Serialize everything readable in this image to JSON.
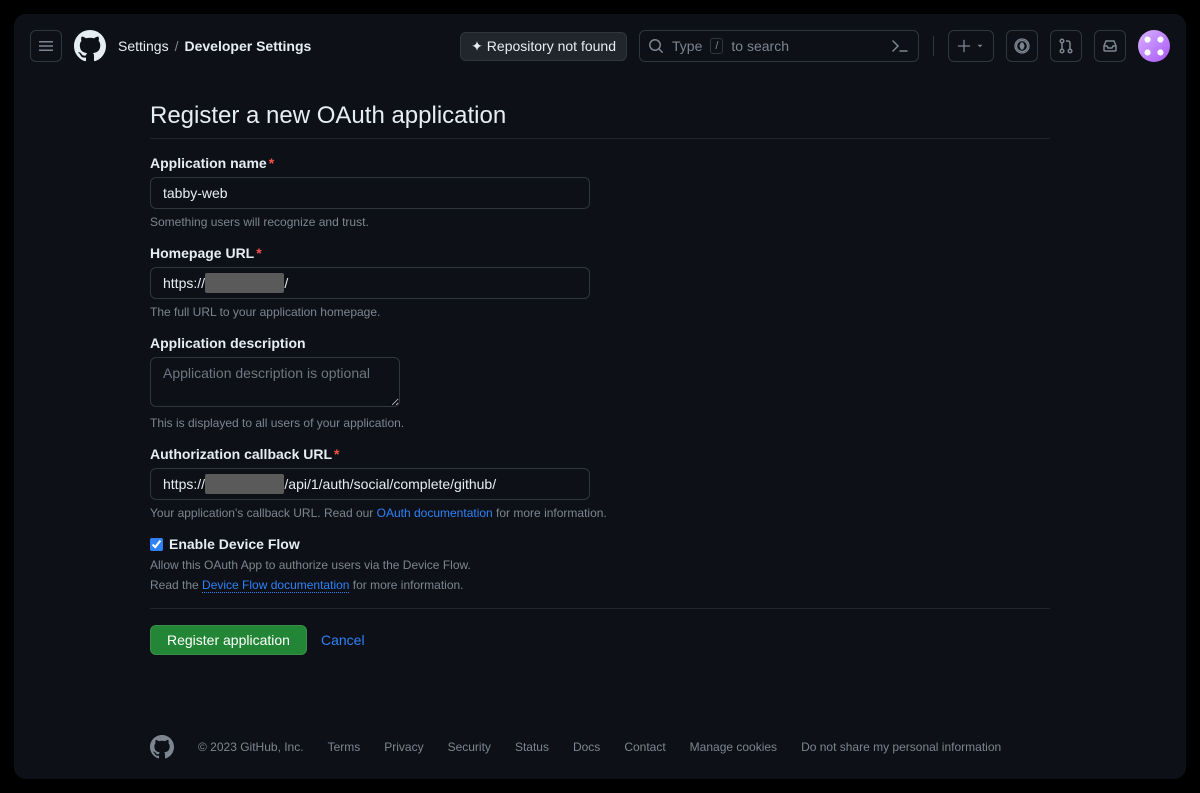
{
  "header": {
    "breadcrumb_root": "Settings",
    "breadcrumb_current": "Developer Settings",
    "repo_not_found": "Repository not found",
    "search_prefix": "Type",
    "search_kbd": "/",
    "search_suffix": "to search"
  },
  "page": {
    "title": "Register a new OAuth application"
  },
  "form": {
    "app_name": {
      "label": "Application name",
      "value": "tabby-web",
      "hint": "Something users will recognize and trust."
    },
    "homepage": {
      "label": "Homepage URL",
      "prefix": "https://",
      "redacted": "████████",
      "suffix": "/",
      "hint": "The full URL to your application homepage."
    },
    "description": {
      "label": "Application description",
      "placeholder": "Application description is optional",
      "hint": "This is displayed to all users of your application."
    },
    "callback": {
      "label": "Authorization callback URL",
      "prefix": "https://",
      "redacted": "████████",
      "suffix": "/api/1/auth/social/complete/github/",
      "hint_prefix": "Your application's callback URL. Read our ",
      "hint_link": "OAuth documentation",
      "hint_suffix": " for more information."
    },
    "device_flow": {
      "label": "Enable Device Flow",
      "checked": true,
      "hint1": "Allow this OAuth App to authorize users via the Device Flow.",
      "hint2_prefix": "Read the ",
      "hint2_link": "Device Flow documentation",
      "hint2_suffix": " for more information."
    },
    "actions": {
      "submit": "Register application",
      "cancel": "Cancel"
    }
  },
  "footer": {
    "copyright": "© 2023 GitHub, Inc.",
    "links": [
      "Terms",
      "Privacy",
      "Security",
      "Status",
      "Docs",
      "Contact",
      "Manage cookies",
      "Do not share my personal information"
    ]
  }
}
